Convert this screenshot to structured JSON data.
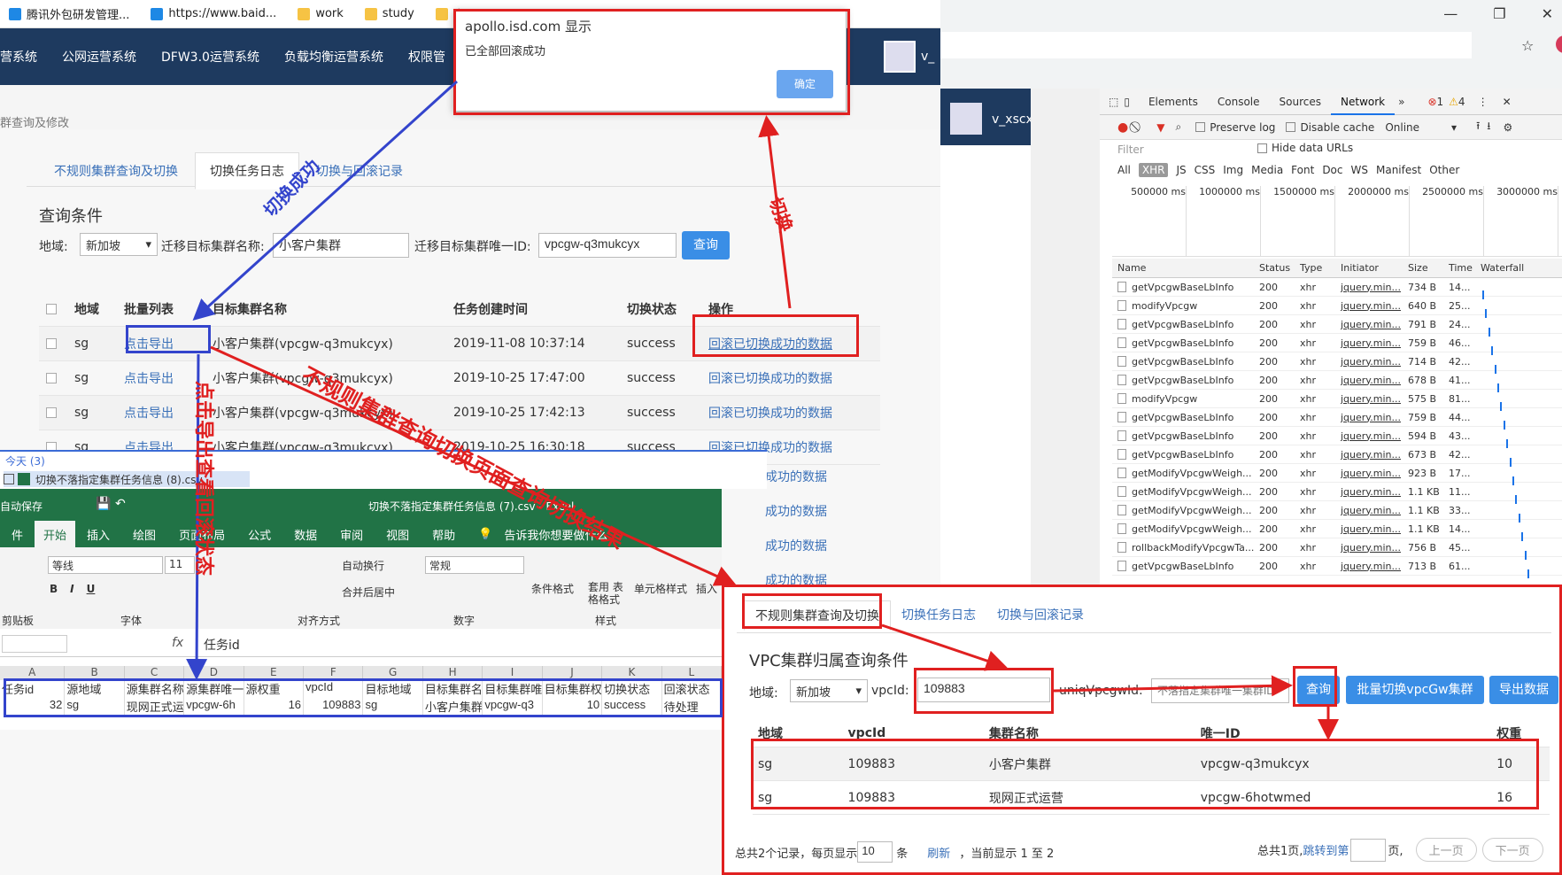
{
  "bookmarks": [
    {
      "label": "腾讯外包研发管理...",
      "color": "#1e88e5"
    },
    {
      "label": "https://www.baid...",
      "color": "#1e88e5"
    },
    {
      "label": "work",
      "color": "#f6c344"
    },
    {
      "label": "study",
      "color": "#f6c344"
    },
    {
      "label": "电影下",
      "color": "#f6c344"
    }
  ],
  "nav": {
    "items": [
      "营系统",
      "公网运营系统",
      "DFW3.0运营系统",
      "负载均衡运营系统",
      "权限管"
    ],
    "user": "v_",
    "user_full": "v_xscxu(徐三春)"
  },
  "breadcrumb": "群查询及修改",
  "tabs": [
    "不规则集群查询及切换",
    "切换任务日志",
    "切换与回滚记录"
  ],
  "query": {
    "title": "查询条件",
    "region_label": "地域:",
    "region_value": "新加坡",
    "name_label": "迁移目标集群名称:",
    "name_value": "小客户集群",
    "id_label": "迁移目标集群唯一ID:",
    "id_value": "vpcgw-q3mukcyx",
    "button": "查询"
  },
  "task_table": {
    "headers": [
      "地域",
      "批量列表",
      "目标集群名称",
      "任务创建时间",
      "切换状态",
      "操作"
    ],
    "rows": [
      {
        "region": "sg",
        "export": "点击导出",
        "name": "小客户集群(vpcgw-q3mukcyx)",
        "time": "2019-11-08 10:37:14",
        "status": "success",
        "op": "回滚已切换成功的数据"
      },
      {
        "region": "sg",
        "export": "点击导出",
        "name": "小客户集群(vpcgw-q3mukcyx)",
        "time": "2019-10-25 17:47:00",
        "status": "success",
        "op": "回滚已切换成功的数据"
      },
      {
        "region": "sg",
        "export": "点击导出",
        "name": "小客户集群(vpcgw-q3mukcyx)",
        "time": "2019-10-25 17:42:13",
        "status": "success",
        "op": "回滚已切换成功的数据"
      },
      {
        "region": "sg",
        "export": "点击导出",
        "name": "小客户集群(vpcgw-q3mukcyx)",
        "time": "2019-10-25 16:30:18",
        "status": "success",
        "op": "回滚已切换成功的数据"
      }
    ],
    "extra_ops": [
      "成功的数据",
      "成功的数据",
      "成功的数据",
      "成功的数据"
    ]
  },
  "alert": {
    "title": "apollo.isd.com 显示",
    "message": "已全部回滚成功",
    "ok": "确定"
  },
  "downloads": {
    "group": "今天 (3)",
    "file": "切换不落指定集群任务信息 (8).csv"
  },
  "excel": {
    "title": "切换不落指定集群任务信息 (7).csv  -  Excel",
    "autosave": "自动保存",
    "tabs": [
      "件",
      "开始",
      "插入",
      "绘图",
      "页面布局",
      "公式",
      "数据",
      "审阅",
      "视图",
      "帮助"
    ],
    "tell": "告诉我你想要做什么",
    "font": "等线",
    "font_size": "11",
    "wrap": "自动换行",
    "merge": "合并后居中",
    "numfmt": "常规",
    "groups": [
      "剪贴板",
      "字体",
      "对齐方式",
      "数字",
      "样式"
    ],
    "cond": "条件格式",
    "table": "套用\n表格格式",
    "cellstyle": "单元格样式",
    "insert": "插入",
    "formula_label": "fx",
    "formula_value": "任务id",
    "cols": [
      "A",
      "B",
      "C",
      "D",
      "E",
      "F",
      "G",
      "H",
      "I",
      "J",
      "K",
      "L"
    ],
    "header_row": [
      "任务id",
      "源地域",
      "源集群名称",
      "源集群唯一",
      "源权重",
      "vpcId",
      "目标地域",
      "目标集群名",
      "目标集群唯",
      "目标集群权",
      "切换状态",
      "回滚状态"
    ],
    "data_row": [
      "32",
      "sg",
      "现网正式运",
      "vpcgw-6h",
      "16",
      "109883",
      "sg",
      "小客户集群",
      "vpcgw-q3",
      "10",
      "success",
      "待处理"
    ]
  },
  "devtools": {
    "tabs": [
      "Elements",
      "Console",
      "Sources",
      "Network"
    ],
    "errors": "1",
    "warnings": "4",
    "preserve": "Preserve log",
    "disable": "Disable cache",
    "online": "Online",
    "filter": "Filter",
    "hide": "Hide data URLs",
    "types": [
      "All",
      "XHR",
      "JS",
      "CSS",
      "Img",
      "Media",
      "Font",
      "Doc",
      "WS",
      "Manifest",
      "Other"
    ],
    "ticks": [
      "500000 ms",
      "1000000 ms",
      "1500000 ms",
      "2000000 ms",
      "2500000 ms",
      "3000000 ms"
    ],
    "headers": [
      "Name",
      "Status",
      "Type",
      "Initiator",
      "Size",
      "Time",
      "Waterfall"
    ],
    "rows": [
      [
        "getVpcgwBaseLbInfo",
        "200",
        "xhr",
        "jquery.min...",
        "734 B",
        "14..."
      ],
      [
        "modifyVpcgw",
        "200",
        "xhr",
        "jquery.min...",
        "640 B",
        "25..."
      ],
      [
        "getVpcgwBaseLbInfo",
        "200",
        "xhr",
        "jquery.min...",
        "791 B",
        "24..."
      ],
      [
        "getVpcgwBaseLbInfo",
        "200",
        "xhr",
        "jquery.min...",
        "759 B",
        "46..."
      ],
      [
        "getVpcgwBaseLbInfo",
        "200",
        "xhr",
        "jquery.min...",
        "714 B",
        "42..."
      ],
      [
        "getVpcgwBaseLbInfo",
        "200",
        "xhr",
        "jquery.min...",
        "678 B",
        "41..."
      ],
      [
        "modifyVpcgw",
        "200",
        "xhr",
        "jquery.min...",
        "575 B",
        "81..."
      ],
      [
        "getVpcgwBaseLbInfo",
        "200",
        "xhr",
        "jquery.min...",
        "759 B",
        "44..."
      ],
      [
        "getVpcgwBaseLbInfo",
        "200",
        "xhr",
        "jquery.min...",
        "594 B",
        "43..."
      ],
      [
        "getVpcgwBaseLbInfo",
        "200",
        "xhr",
        "jquery.min...",
        "673 B",
        "42..."
      ],
      [
        "getModifyVpcgwWeigh...",
        "200",
        "xhr",
        "jquery.min...",
        "923 B",
        "17..."
      ],
      [
        "getModifyVpcgwWeigh...",
        "200",
        "xhr",
        "jquery.min...",
        "1.1 KB",
        "11..."
      ],
      [
        "getModifyVpcgwWeigh...",
        "200",
        "xhr",
        "jquery.min...",
        "1.1 KB",
        "33..."
      ],
      [
        "getModifyVpcgwWeigh...",
        "200",
        "xhr",
        "jquery.min...",
        "1.1 KB",
        "14..."
      ],
      [
        "rollbackModifyVpcgwTa...",
        "200",
        "xhr",
        "jquery.min...",
        "756 B",
        "45..."
      ],
      [
        "getVpcgwBaseLbInfo",
        "200",
        "xhr",
        "jquery.min...",
        "713 B",
        "61..."
      ]
    ]
  },
  "vpc": {
    "tabs": [
      "不规则集群查询及切换",
      "切换任务日志",
      "切换与回滚记录"
    ],
    "title": "VPC集群归属查询条件",
    "region_label": "地域:",
    "region_value": "新加坡",
    "vpcid_label": "vpcId:",
    "vpcid_value": "109883",
    "uniq_label": "uniqVpcgwId:",
    "uniq_placeholder": "不落指定集群唯一集群ID",
    "query": "查询",
    "batch": "批量切换vpcGw集群",
    "export": "导出数据",
    "headers": [
      "地域",
      "vpcId",
      "集群名称",
      "唯一ID",
      "权重"
    ],
    "rows": [
      [
        "sg",
        "109883",
        "小客户集群",
        "vpcgw-q3mukcyx",
        "10"
      ],
      [
        "sg",
        "109883",
        "现网正式运营",
        "vpcgw-6hotwmed",
        "16"
      ]
    ],
    "footer": {
      "total": "总共2个记录，每页显示",
      "per_page": "10",
      "unit": "条",
      "refresh": "刷新",
      "current": "，当前显示 1 至 2",
      "pages": "总共1页,",
      "jump": "跳转到第",
      "page_unit": "页,",
      "prev": "上一页",
      "next": "下一页"
    }
  },
  "annotations": {
    "switch_success": "切换成功",
    "switch": "切换",
    "export_check": "点击导出查看回滚状态",
    "query_result": "不规则集群查询切换页面查询切换结果"
  },
  "colors": {
    "red": "#e02020",
    "blue": "#3344cc",
    "nav": "#1e3a5f",
    "excel": "#217346",
    "primary": "#3a8ee6"
  }
}
